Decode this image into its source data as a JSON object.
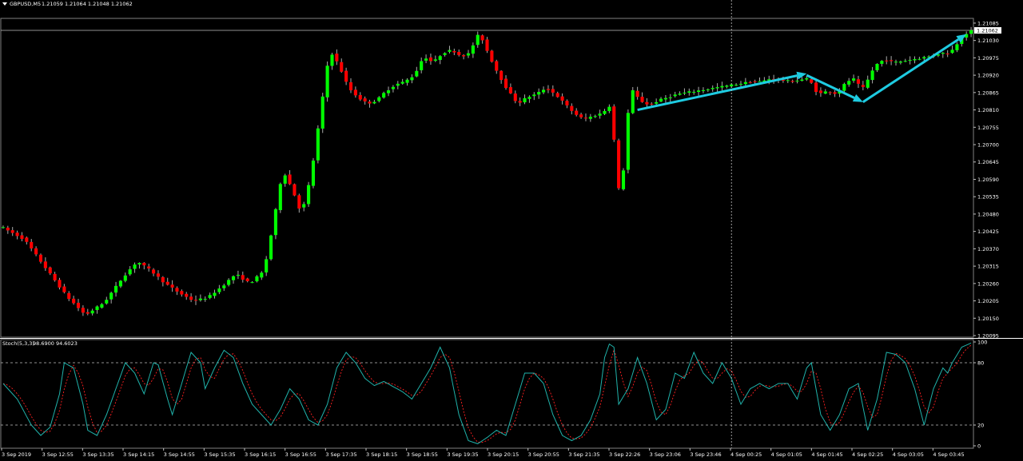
{
  "header": {
    "symbol_label": "GBPUSD,M5",
    "ohlc_text": "1.21059 1.21064 1.21048 1.21062",
    "stoch_label": "Stoch(5,3,3)",
    "stoch_values": "98.6900 94.6023"
  },
  "colors": {
    "background": "#000000",
    "bull_candle": "#00ff00",
    "bear_candle": "#ff0000",
    "wick": "#aaaaaa",
    "grid": "#c0c0c0",
    "stoch_main": "#20b2aa",
    "stoch_signal": "#ff2020",
    "arrow": "#1ecbe1"
  },
  "chart_data": [
    {
      "type": "candlestick",
      "symbol": "GBPUSD",
      "timeframe": "M5",
      "price_ticks": [
        "1.21085",
        "1.21030",
        "1.20975",
        "1.20920",
        "1.20865",
        "1.20810",
        "1.20755",
        "1.20700",
        "1.20645",
        "1.20590",
        "1.20535",
        "1.20480",
        "1.20425",
        "1.20370",
        "1.20315",
        "1.20260",
        "1.20205",
        "1.20150",
        "1.20095"
      ],
      "current_price_label": "1.21062",
      "ylim": [
        1.2009,
        1.211
      ],
      "x_tick_labels": [
        "3 Sep 2019",
        "3 Sep 12:55",
        "3 Sep 13:35",
        "3 Sep 14:15",
        "3 Sep 14:55",
        "3 Sep 15:35",
        "3 Sep 16:15",
        "3 Sep 16:55",
        "3 Sep 17:35",
        "3 Sep 18:15",
        "3 Sep 18:55",
        "3 Sep 19:35",
        "3 Sep 20:15",
        "3 Sep 20:55",
        "3 Sep 21:35",
        "3 Sep 22:26",
        "3 Sep 23:06",
        "3 Sep 23:46",
        "4 Sep 00:25",
        "4 Sep 01:05",
        "4 Sep 01:45",
        "4 Sep 02:25",
        "4 Sep 03:05",
        "4 Sep 03:45"
      ],
      "price_path": [
        [
          0,
          1.2044
        ],
        [
          5,
          1.204
        ],
        [
          10,
          1.203
        ],
        [
          14,
          1.2022
        ],
        [
          18,
          1.2016
        ],
        [
          22,
          1.202
        ],
        [
          26,
          1.2028
        ],
        [
          29,
          1.2033
        ],
        [
          32,
          1.203
        ],
        [
          35,
          1.2026
        ],
        [
          38,
          1.2023
        ],
        [
          41,
          1.20205
        ],
        [
          44,
          1.20215
        ],
        [
          47,
          1.2025
        ],
        [
          50,
          1.2029
        ],
        [
          53,
          1.2026
        ],
        [
          56,
          1.203
        ],
        [
          58,
          1.2045
        ],
        [
          60,
          1.2062
        ],
        [
          62,
          1.2056
        ],
        [
          64,
          1.2048
        ],
        [
          66,
          1.206
        ],
        [
          67,
          1.207
        ],
        [
          68,
          1.208
        ],
        [
          69,
          1.209
        ],
        [
          70,
          1.21
        ],
        [
          72,
          1.2095
        ],
        [
          74,
          1.2088
        ],
        [
          76,
          1.2085
        ],
        [
          78,
          1.2083
        ],
        [
          80,
          1.2084
        ],
        [
          82,
          1.2087
        ],
        [
          84,
          1.2089
        ],
        [
          86,
          1.209
        ],
        [
          88,
          1.2092
        ],
        [
          90,
          1.2098
        ],
        [
          92,
          1.2096
        ],
        [
          94,
          1.2099
        ],
        [
          96,
          1.21
        ],
        [
          98,
          1.2098
        ],
        [
          100,
          1.2099
        ],
        [
          101,
          1.2104
        ],
        [
          102,
          1.2105
        ],
        [
          104,
          1.2098
        ],
        [
          106,
          1.2092
        ],
        [
          108,
          1.2087
        ],
        [
          110,
          1.2083
        ],
        [
          112,
          1.2085
        ],
        [
          114,
          1.2086
        ],
        [
          116,
          1.2088
        ],
        [
          118,
          1.2086
        ],
        [
          120,
          1.2083
        ],
        [
          122,
          1.208
        ],
        [
          124,
          1.2078
        ],
        [
          126,
          1.2079
        ],
        [
          128,
          1.208
        ],
        [
          130,
          1.2083
        ],
        [
          131,
          1.206
        ],
        [
          132,
          1.2052
        ],
        [
          133,
          1.2072
        ],
        [
          134,
          1.2088
        ],
        [
          136,
          1.2084
        ],
        [
          138,
          1.20825
        ],
        [
          140,
          1.2084
        ],
        [
          142,
          1.2085
        ],
        [
          144,
          1.2086
        ],
        [
          146,
          1.20865
        ],
        [
          148,
          1.2087
        ],
        [
          150,
          1.20875
        ],
        [
          152,
          1.2088
        ],
        [
          154,
          1.20885
        ],
        [
          156,
          1.2089
        ],
        [
          158,
          1.20895
        ],
        [
          160,
          1.209
        ],
        [
          162,
          1.209
        ],
        [
          164,
          1.2091
        ],
        [
          166,
          1.20905
        ],
        [
          168,
          1.209
        ],
        [
          170,
          1.20905
        ],
        [
          172,
          1.2091
        ],
        [
          173,
          1.2088
        ],
        [
          174,
          1.2086
        ],
        [
          176,
          1.2087
        ],
        [
          178,
          1.2086
        ],
        [
          180,
          1.209
        ],
        [
          182,
          1.2091
        ],
        [
          183,
          1.2087
        ],
        [
          184,
          1.2089
        ],
        [
          186,
          1.2095
        ],
        [
          188,
          1.2097
        ],
        [
          190,
          1.2096
        ],
        [
          192,
          1.20965
        ],
        [
          194,
          1.2097
        ],
        [
          196,
          1.20975
        ],
        [
          198,
          1.2098
        ],
        [
          200,
          1.2099
        ],
        [
          202,
          1.2099
        ],
        [
          204,
          1.2103
        ],
        [
          206,
          1.2106
        ]
      ],
      "annotations": [
        {
          "type": "arrow",
          "from": [
            135,
            1.2081
          ],
          "to": [
            171,
            1.20925
          ]
        },
        {
          "type": "arrow",
          "from": [
            171,
            1.2092
          ],
          "to": [
            183,
            1.20835
          ]
        },
        {
          "type": "arrow",
          "from": [
            183,
            1.20835
          ],
          "to": [
            205,
            1.2105
          ]
        }
      ],
      "vertical_marker_at": 155
    },
    {
      "type": "line",
      "title": "Stoch(5,3,3)",
      "ylim": [
        0,
        100
      ],
      "y_ticks": [
        "100",
        "80",
        "20",
        "0"
      ],
      "levels": [
        80,
        20
      ],
      "stoch_path": [
        [
          0,
          60
        ],
        [
          3,
          45
        ],
        [
          6,
          20
        ],
        [
          8,
          10
        ],
        [
          10,
          18
        ],
        [
          12,
          50
        ],
        [
          13,
          80
        ],
        [
          15,
          75
        ],
        [
          17,
          40
        ],
        [
          18,
          15
        ],
        [
          20,
          10
        ],
        [
          22,
          30
        ],
        [
          24,
          55
        ],
        [
          26,
          80
        ],
        [
          28,
          70
        ],
        [
          30,
          50
        ],
        [
          32,
          80
        ],
        [
          33,
          78
        ],
        [
          35,
          45
        ],
        [
          36,
          30
        ],
        [
          38,
          60
        ],
        [
          40,
          90
        ],
        [
          42,
          80
        ],
        [
          43,
          55
        ],
        [
          45,
          75
        ],
        [
          47,
          92
        ],
        [
          49,
          85
        ],
        [
          51,
          60
        ],
        [
          53,
          40
        ],
        [
          55,
          30
        ],
        [
          57,
          20
        ],
        [
          59,
          35
        ],
        [
          61,
          55
        ],
        [
          63,
          45
        ],
        [
          65,
          25
        ],
        [
          67,
          20
        ],
        [
          69,
          40
        ],
        [
          71,
          75
        ],
        [
          73,
          90
        ],
        [
          75,
          80
        ],
        [
          77,
          65
        ],
        [
          79,
          58
        ],
        [
          81,
          62
        ],
        [
          83,
          57
        ],
        [
          85,
          52
        ],
        [
          87,
          45
        ],
        [
          89,
          60
        ],
        [
          91,
          75
        ],
        [
          93,
          95
        ],
        [
          95,
          75
        ],
        [
          97,
          30
        ],
        [
          99,
          5
        ],
        [
          101,
          2
        ],
        [
          103,
          8
        ],
        [
          105,
          15
        ],
        [
          107,
          10
        ],
        [
          109,
          40
        ],
        [
          111,
          70
        ],
        [
          113,
          70
        ],
        [
          115,
          60
        ],
        [
          117,
          30
        ],
        [
          119,
          10
        ],
        [
          121,
          5
        ],
        [
          123,
          10
        ],
        [
          125,
          25
        ],
        [
          127,
          50
        ],
        [
          128,
          85
        ],
        [
          129,
          98
        ],
        [
          130,
          95
        ],
        [
          131,
          40
        ],
        [
          133,
          55
        ],
        [
          135,
          85
        ],
        [
          137,
          60
        ],
        [
          139,
          25
        ],
        [
          141,
          35
        ],
        [
          143,
          70
        ],
        [
          145,
          65
        ],
        [
          147,
          90
        ],
        [
          149,
          70
        ],
        [
          151,
          60
        ],
        [
          153,
          80
        ],
        [
          155,
          65
        ],
        [
          157,
          40
        ],
        [
          159,
          55
        ],
        [
          161,
          60
        ],
        [
          163,
          55
        ],
        [
          165,
          60
        ],
        [
          167,
          60
        ],
        [
          169,
          45
        ],
        [
          171,
          75
        ],
        [
          172,
          80
        ],
        [
          174,
          30
        ],
        [
          176,
          15
        ],
        [
          178,
          30
        ],
        [
          180,
          55
        ],
        [
          182,
          60
        ],
        [
          184,
          15
        ],
        [
          186,
          45
        ],
        [
          188,
          90
        ],
        [
          190,
          88
        ],
        [
          192,
          80
        ],
        [
          194,
          55
        ],
        [
          196,
          20
        ],
        [
          198,
          55
        ],
        [
          200,
          75
        ],
        [
          201,
          70
        ],
        [
          202,
          80
        ],
        [
          204,
          95
        ],
        [
          206,
          99
        ]
      ]
    }
  ]
}
